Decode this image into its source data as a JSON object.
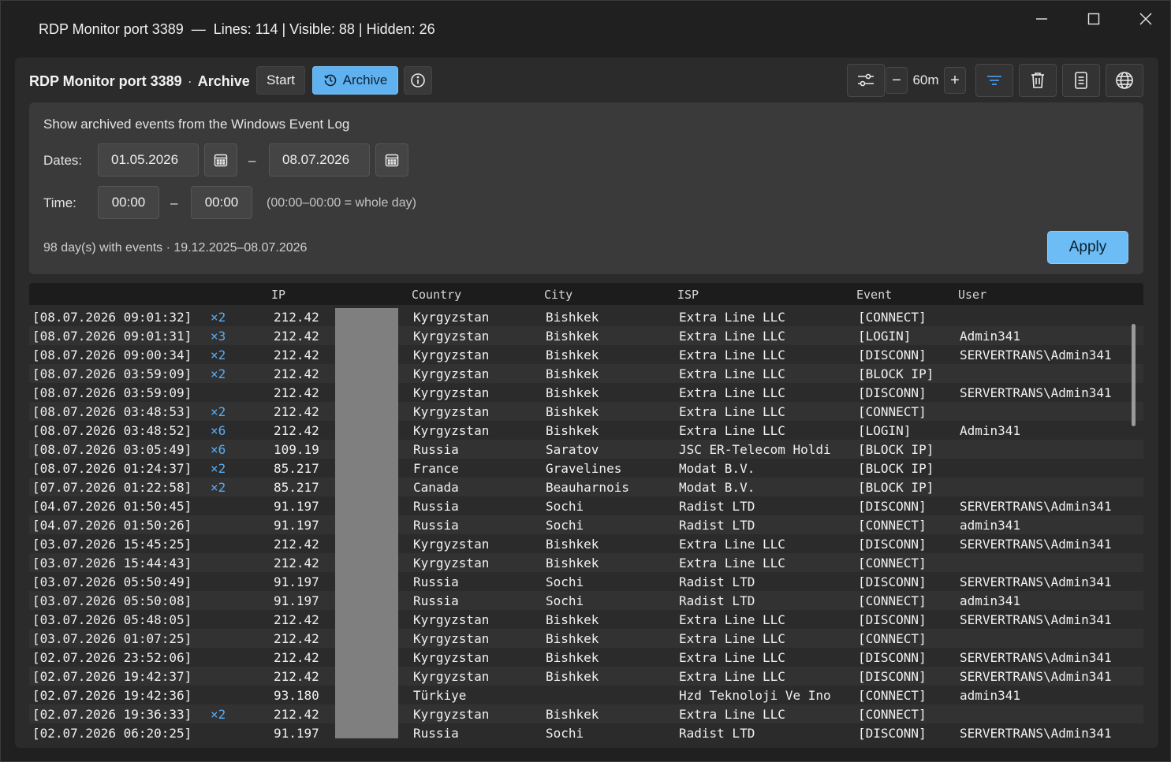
{
  "window": {
    "title": "RDP Monitor port 3389  —  Lines: 114 | Visible: 88 | Hidden: 26"
  },
  "toolbar": {
    "app_name": "RDP Monitor port 3389",
    "separator": "·",
    "mode": "Archive",
    "start_label": "Start",
    "archive_label": "Archive",
    "interval_value": "60m",
    "minus_label": "−",
    "plus_label": "+"
  },
  "archive": {
    "description": "Show archived events from the Windows Event Log",
    "dates_label": "Dates:",
    "date_from": "01.05.2026",
    "date_to": "08.07.2026",
    "dash": "–",
    "time_label": "Time:",
    "time_from": "00:00",
    "time_to": "00:00",
    "time_hint": "(00:00–00:00 = whole day)",
    "summary": "98 day(s) with events · 19.12.2025–08.07.2026",
    "apply_label": "Apply"
  },
  "table": {
    "columns": [
      "IP",
      "Country",
      "City",
      "ISP",
      "Event",
      "User"
    ],
    "rows": [
      {
        "ts": "[08.07.2026 09:01:32]",
        "mult": "×2",
        "ip": "212.42",
        "country": "Kyrgyzstan",
        "city": "Bishkek",
        "isp": "Extra Line LLC",
        "event": "[CONNECT]",
        "user": ""
      },
      {
        "ts": "[08.07.2026 09:01:31]",
        "mult": "×3",
        "ip": "212.42",
        "country": "Kyrgyzstan",
        "city": "Bishkek",
        "isp": "Extra Line LLC",
        "event": "[LOGIN]",
        "user": "Admin341"
      },
      {
        "ts": "[08.07.2026 09:00:34]",
        "mult": "×2",
        "ip": "212.42",
        "country": "Kyrgyzstan",
        "city": "Bishkek",
        "isp": "Extra Line LLC",
        "event": "[DISCONN]",
        "user": "SERVERTRANS\\Admin341"
      },
      {
        "ts": "[08.07.2026 03:59:09]",
        "mult": "×2",
        "ip": "212.42",
        "country": "Kyrgyzstan",
        "city": "Bishkek",
        "isp": "Extra Line LLC",
        "event": "[BLOCK IP]",
        "user": ""
      },
      {
        "ts": "[08.07.2026 03:59:09]",
        "mult": "",
        "ip": "212.42",
        "country": "Kyrgyzstan",
        "city": "Bishkek",
        "isp": "Extra Line LLC",
        "event": "[DISCONN]",
        "user": "SERVERTRANS\\Admin341"
      },
      {
        "ts": "[08.07.2026 03:48:53]",
        "mult": "×2",
        "ip": "212.42",
        "country": "Kyrgyzstan",
        "city": "Bishkek",
        "isp": "Extra Line LLC",
        "event": "[CONNECT]",
        "user": ""
      },
      {
        "ts": "[08.07.2026 03:48:52]",
        "mult": "×6",
        "ip": "212.42",
        "country": "Kyrgyzstan",
        "city": "Bishkek",
        "isp": "Extra Line LLC",
        "event": "[LOGIN]",
        "user": "Admin341"
      },
      {
        "ts": "[08.07.2026 03:05:49]",
        "mult": "×6",
        "ip": "109.19",
        "country": "Russia",
        "city": "Saratov",
        "isp": "JSC ER-Telecom Holdi",
        "event": "[BLOCK IP]",
        "user": ""
      },
      {
        "ts": "[08.07.2026 01:24:37]",
        "mult": "×2",
        "ip": "85.217",
        "country": "France",
        "city": "Gravelines",
        "isp": "Modat B.V.",
        "event": "[BLOCK IP]",
        "user": ""
      },
      {
        "ts": "[07.07.2026 01:22:58]",
        "mult": "×2",
        "ip": "85.217",
        "country": "Canada",
        "city": "Beauharnois",
        "isp": "Modat B.V.",
        "event": "[BLOCK IP]",
        "user": ""
      },
      {
        "ts": "[04.07.2026 01:50:45]",
        "mult": "",
        "ip": "91.197",
        "country": "Russia",
        "city": "Sochi",
        "isp": "Radist LTD",
        "event": "[DISCONN]",
        "user": "SERVERTRANS\\Admin341"
      },
      {
        "ts": "[04.07.2026 01:50:26]",
        "mult": "",
        "ip": "91.197",
        "country": "Russia",
        "city": "Sochi",
        "isp": "Radist LTD",
        "event": "[CONNECT]",
        "user": "admin341"
      },
      {
        "ts": "[03.07.2026 15:45:25]",
        "mult": "",
        "ip": "212.42",
        "country": "Kyrgyzstan",
        "city": "Bishkek",
        "isp": "Extra Line LLC",
        "event": "[DISCONN]",
        "user": "SERVERTRANS\\Admin341"
      },
      {
        "ts": "[03.07.2026 15:44:43]",
        "mult": "",
        "ip": "212.42",
        "country": "Kyrgyzstan",
        "city": "Bishkek",
        "isp": "Extra Line LLC",
        "event": "[CONNECT]",
        "user": ""
      },
      {
        "ts": "[03.07.2026 05:50:49]",
        "mult": "",
        "ip": "91.197",
        "country": "Russia",
        "city": "Sochi",
        "isp": "Radist LTD",
        "event": "[DISCONN]",
        "user": "SERVERTRANS\\Admin341"
      },
      {
        "ts": "[03.07.2026 05:50:08]",
        "mult": "",
        "ip": "91.197",
        "country": "Russia",
        "city": "Sochi",
        "isp": "Radist LTD",
        "event": "[CONNECT]",
        "user": "admin341"
      },
      {
        "ts": "[03.07.2026 05:48:05]",
        "mult": "",
        "ip": "212.42",
        "country": "Kyrgyzstan",
        "city": "Bishkek",
        "isp": "Extra Line LLC",
        "event": "[DISCONN]",
        "user": "SERVERTRANS\\Admin341"
      },
      {
        "ts": "[03.07.2026 01:07:25]",
        "mult": "",
        "ip": "212.42",
        "country": "Kyrgyzstan",
        "city": "Bishkek",
        "isp": "Extra Line LLC",
        "event": "[CONNECT]",
        "user": ""
      },
      {
        "ts": "[02.07.2026 23:52:06]",
        "mult": "",
        "ip": "212.42",
        "country": "Kyrgyzstan",
        "city": "Bishkek",
        "isp": "Extra Line LLC",
        "event": "[DISCONN]",
        "user": "SERVERTRANS\\Admin341"
      },
      {
        "ts": "[02.07.2026 19:42:37]",
        "mult": "",
        "ip": "212.42",
        "country": "Kyrgyzstan",
        "city": "Bishkek",
        "isp": "Extra Line LLC",
        "event": "[DISCONN]",
        "user": "SERVERTRANS\\Admin341"
      },
      {
        "ts": "[02.07.2026 19:42:36]",
        "mult": "",
        "ip": "93.180",
        "country": "Türkiye",
        "city": "",
        "isp": "Hzd Teknoloji Ve Ino",
        "event": "[CONNECT]",
        "user": "admin341"
      },
      {
        "ts": "[02.07.2026 19:36:33]",
        "mult": "×2",
        "ip": "212.42",
        "country": "Kyrgyzstan",
        "city": "Bishkek",
        "isp": "Extra Line LLC",
        "event": "[CONNECT]",
        "user": ""
      },
      {
        "ts": "[02.07.2026 06:20:25]",
        "mult": "",
        "ip": "91.197",
        "country": "Russia",
        "city": "Sochi",
        "isp": "Radist LTD",
        "event": "[DISCONN]",
        "user": "SERVERTRANS\\Admin341"
      }
    ]
  },
  "icons": {
    "archive": "history-icon",
    "info": "info-icon",
    "settings": "sliders-icon",
    "filter": "filter-icon",
    "delete": "trash-icon",
    "log": "document-icon",
    "geo": "globe-icon",
    "calendar": "calendar-icon"
  },
  "colors": {
    "accent": "#5fb1f0",
    "multiplier": "#5aabf0",
    "filter_icon": "#4da6ff"
  }
}
